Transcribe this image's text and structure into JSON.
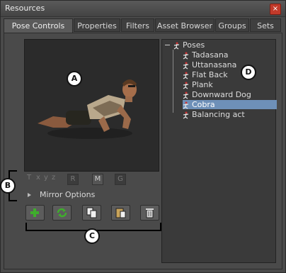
{
  "window": {
    "title": "Resources",
    "close_label": "×"
  },
  "tabs": [
    {
      "label": "Pose Controls",
      "active": true
    },
    {
      "label": "Properties",
      "active": false
    },
    {
      "label": "Filters",
      "active": false
    },
    {
      "label": "Asset Browser",
      "active": false
    },
    {
      "label": "Groups",
      "active": false
    },
    {
      "label": "Sets",
      "active": false
    }
  ],
  "controls": {
    "t": "T",
    "x": "x",
    "y": "y",
    "z": "z",
    "r": "R",
    "m": "M",
    "g": "G",
    "mirror_label": "Mirror Options"
  },
  "toolbar_icons": [
    "add-icon",
    "refresh-icon",
    "copy-icon",
    "paste-icon",
    "delete-icon"
  ],
  "callouts": {
    "a": "A",
    "b": "B",
    "c": "C",
    "d": "D"
  },
  "tree": {
    "root": "Poses",
    "items": [
      "Tadasana",
      "Uttanasana",
      "Flat Back",
      "Plank",
      "Downward Dog",
      "Cobra",
      "Balancing act"
    ],
    "selected": "Cobra"
  },
  "colors": {
    "selection": "#6e90b8",
    "close": "#c23a2a",
    "add": "#3fae2c"
  }
}
